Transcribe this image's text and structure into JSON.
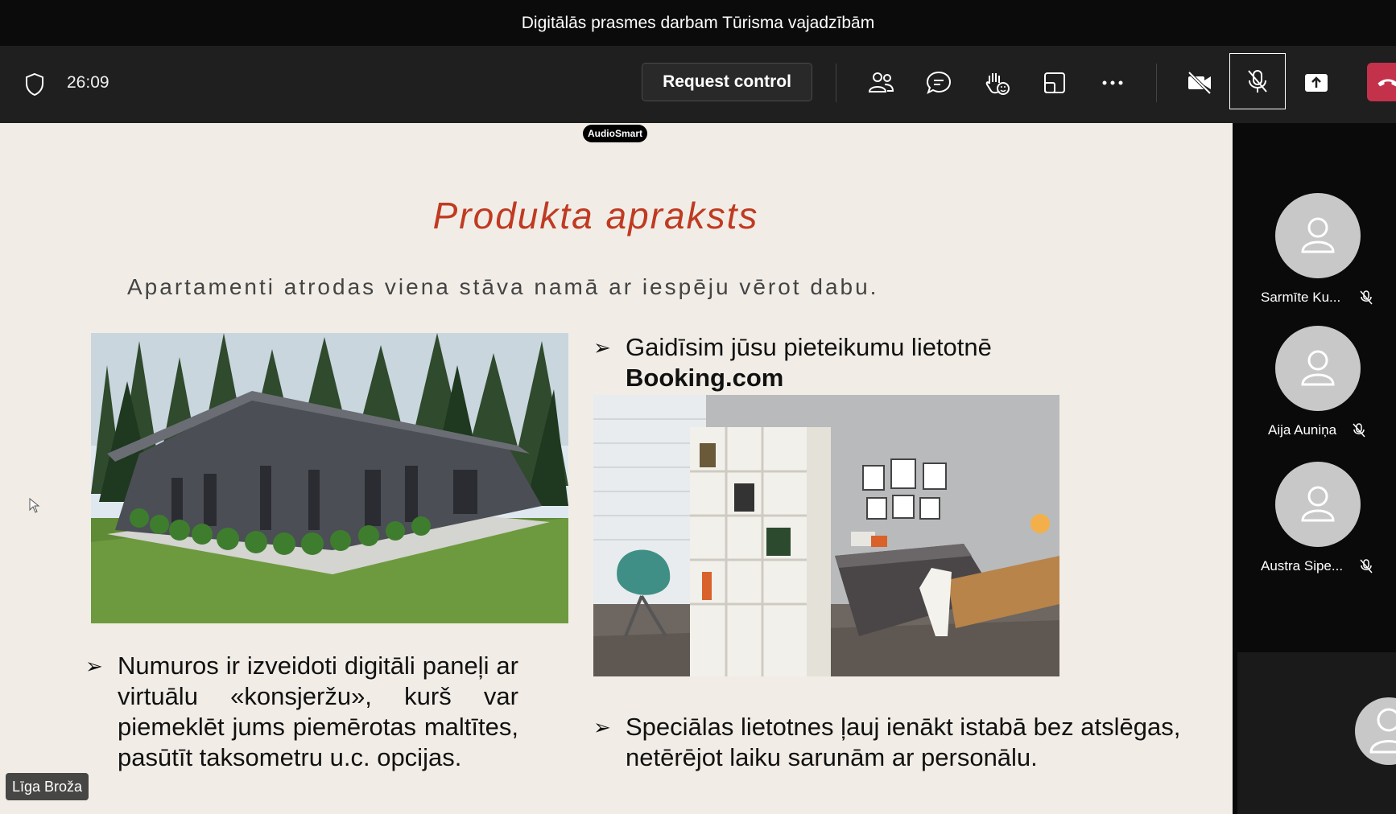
{
  "window": {
    "title": "Digitālās prasmes darbam Tūrisma vajadzībām"
  },
  "toolbar": {
    "timer": "26:09",
    "request_control_label": "Request control"
  },
  "slide": {
    "badge": "AudioSmart",
    "title": "Produkta apraksts",
    "subtitle": "Apartamenti atrodas viena stāva namā ar iespēju vērot dabu.",
    "bullet1_line1": "Gaidīsim jūsu pieteikumu  lietotnē",
    "bullet1_line2": "Booking.com",
    "bullet2": "Numuros ir izveidoti digitāli paneļi ar virtuālu «konsjeržu», kurš var piemeklēt jums piemērotas maltītes, pasūtīt taksometru u.c. opcijas.",
    "bullet3": "Speciālas lietotnes ļauj ienākt istabā bez atslēgas, netērējot laiku sarunām ar personālu."
  },
  "presenter": {
    "name": "Līga Broža"
  },
  "participants": [
    {
      "name": "Sarmīte Ku..."
    },
    {
      "name": "Aija Auniņa"
    },
    {
      "name": "Austra Sipe..."
    }
  ],
  "colors": {
    "slide_title": "#c03a22",
    "hangup": "#c4314b",
    "slide_bg": "#f1ede6"
  }
}
